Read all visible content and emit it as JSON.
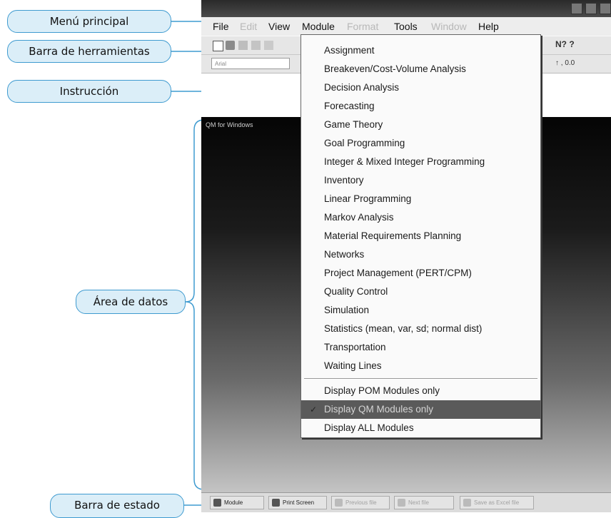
{
  "callouts": {
    "menu": "Menú principal",
    "toolbar": "Barra de herramientas",
    "instruction": "Instrucción",
    "data_area": "Área de datos",
    "status_bar": "Barra de estado"
  },
  "menubar": {
    "items": [
      {
        "label": "File",
        "enabled": true
      },
      {
        "label": "Edit",
        "enabled": false
      },
      {
        "label": "View",
        "enabled": true
      },
      {
        "label": "Module",
        "enabled": true
      },
      {
        "label": "Format",
        "enabled": false
      },
      {
        "label": "Tools",
        "enabled": true
      },
      {
        "label": "Window",
        "enabled": false
      },
      {
        "label": "Help",
        "enabled": true
      }
    ]
  },
  "toolbar": {
    "font_box": "Arial",
    "help_glyph": "N? ?",
    "number_glyph": "↑ , 0.0"
  },
  "data_area": {
    "caption": "QM for Windows"
  },
  "module_menu": {
    "items": [
      "Assignment",
      "Breakeven/Cost-Volume Analysis",
      "Decision Analysis",
      "Forecasting",
      "Game Theory",
      "Goal Programming",
      "Integer & Mixed Integer Programming",
      "Inventory",
      "Linear Programming",
      "Markov Analysis",
      "Material Requirements Planning",
      "Networks",
      "Project Management (PERT/CPM)",
      "Quality Control",
      "Simulation",
      "Statistics (mean, var, sd; normal dist)",
      "Transportation",
      "Waiting Lines"
    ],
    "display_options": [
      {
        "label": "Display POM Modules only",
        "checked": false
      },
      {
        "label": "Display QM Modules only",
        "checked": true
      },
      {
        "label": "Display ALL Modules",
        "checked": false
      }
    ],
    "check_glyph": "✓"
  },
  "status_bar": {
    "buttons": [
      {
        "label": "Module",
        "enabled": true
      },
      {
        "label": "Print Screen",
        "enabled": true
      },
      {
        "label": "Previous file",
        "enabled": false
      },
      {
        "label": "Next file",
        "enabled": false
      },
      {
        "label": "Save as Excel file",
        "enabled": false
      }
    ]
  },
  "colors": {
    "callout_fill": "#dbeef8",
    "callout_border": "#3f9bd0",
    "selected_item": "#5a5a5a"
  }
}
